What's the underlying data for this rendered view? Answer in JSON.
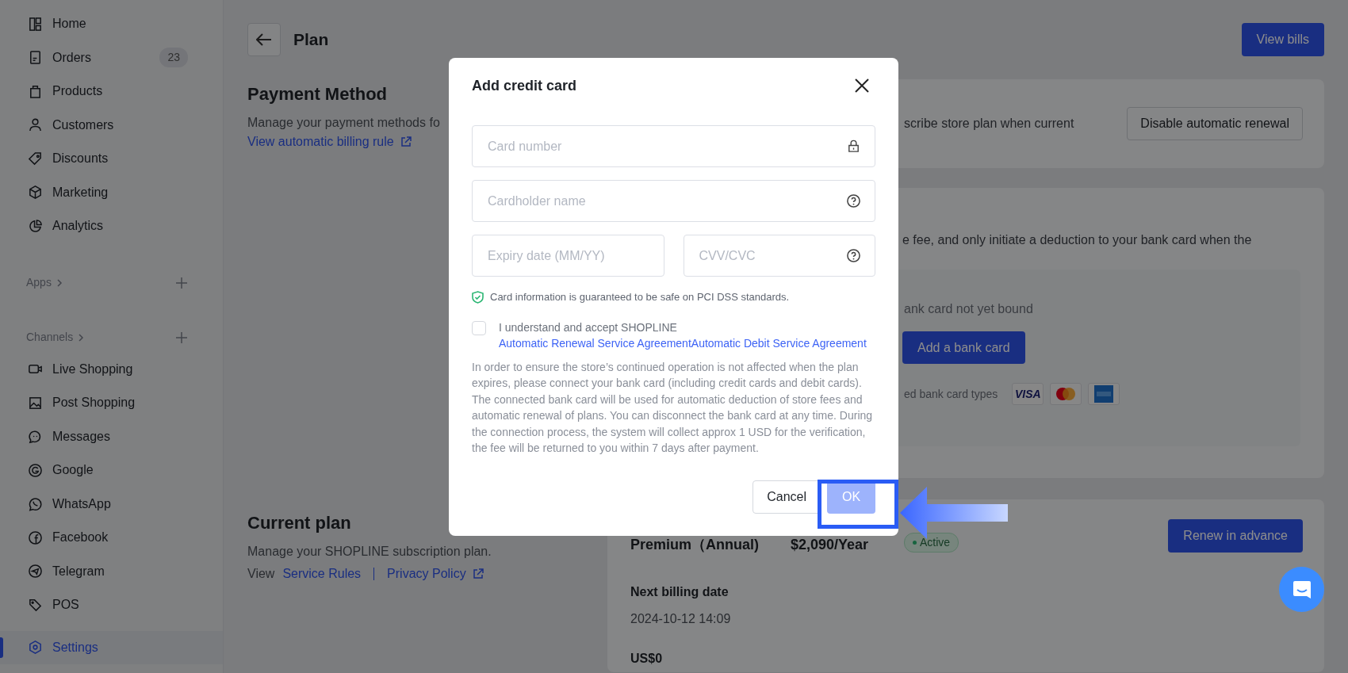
{
  "sidebar": {
    "main_items": [
      {
        "label": "Home",
        "selected": false
      },
      {
        "label": "Orders",
        "selected": false,
        "count": "23"
      },
      {
        "label": "Products",
        "selected": false
      },
      {
        "label": "Customers",
        "selected": false
      },
      {
        "label": "Discounts",
        "selected": false
      },
      {
        "label": "Marketing",
        "selected": false
      },
      {
        "label": "Analytics",
        "selected": false
      }
    ],
    "apps": {
      "label": "Apps"
    },
    "channels": {
      "label": "Channels",
      "items": [
        {
          "label": "Live Shopping",
          "selected": false
        },
        {
          "label": "Post Shopping",
          "selected": false
        },
        {
          "label": "Messages",
          "selected": false
        },
        {
          "label": "Google",
          "selected": false
        },
        {
          "label": "WhatsApp",
          "selected": false
        },
        {
          "label": "Facebook",
          "selected": false
        },
        {
          "label": "Telegram",
          "selected": false
        },
        {
          "label": "POS",
          "selected": false
        }
      ]
    },
    "settings": {
      "label": "Settings",
      "selected": true
    }
  },
  "page": {
    "title": "Plan",
    "view_bills": "View bills"
  },
  "payment_method": {
    "title": "Payment Method",
    "description": "Manage your payment methods fo",
    "link": "View automatic billing rule"
  },
  "auto_renewal_card": {
    "text": "scribe store plan when current",
    "button": "Disable automatic renewal"
  },
  "bank_card_panel": {
    "text": "e fee, and only initiate a deduction to your bank card when the",
    "status": "ank card not yet bound",
    "button": "Add a bank card",
    "types_label": "ed bank card types",
    "brands": [
      {
        "kind": "visa",
        "text": "VISA"
      },
      {
        "kind": "mastercard"
      },
      {
        "kind": "amex"
      }
    ]
  },
  "current_plan": {
    "title": "Current plan",
    "description": "Manage your SHOPLINE subscription plan.",
    "view_label": "View",
    "links": [
      "Service Rules",
      "Privacy Policy"
    ]
  },
  "plan_card": {
    "name": "Premium（Annual)",
    "price": "$2,090/Year",
    "status": "Active",
    "button": "Renew in advance",
    "next_billing_label": "Next billing date",
    "next_billing_date": "2024-10-12 14:09",
    "amount": "US$0"
  },
  "modal": {
    "title": "Add credit card",
    "fields": [
      {
        "placeholder": "Card number"
      },
      {
        "placeholder": "Cardholder name"
      },
      {
        "placeholder": "Expiry date (MM/YY)"
      },
      {
        "placeholder": "CVV/CVC"
      }
    ],
    "security_note": "Card information is guaranteed to be safe on PCI DSS standards.",
    "agreement": {
      "checked": false,
      "text": "I understand and accept  SHOPLINE",
      "links": [
        "Automatic Renewal Service Agreement",
        "Automatic Debit Service Agreement"
      ]
    },
    "notice": "In order to ensure the store’s continued operation is not affected when the plan expires, please connect your bank card (including credit cards and debit cards). The connected bank card will be used for automatic deduction of store fees and automatic renewal of plans. You can disconnect the bank card at any time. During the connection process, the system will collect approx 1 USD for the verification, the fee will be returned to you within 7 days after payment.",
    "cancel": "Cancel",
    "ok": {
      "label": "OK",
      "disabled": true
    }
  }
}
